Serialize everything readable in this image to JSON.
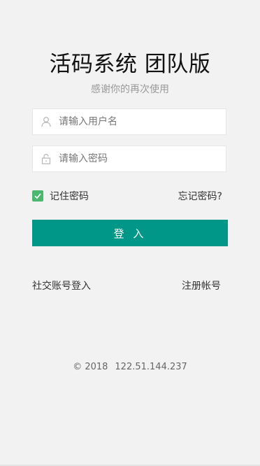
{
  "header": {
    "title": "活码系统 团队版",
    "subtitle": "感谢你的再次使用"
  },
  "form": {
    "username_placeholder": "请输入用户名",
    "username_value": "",
    "password_placeholder": "请输入密码",
    "password_value": "",
    "remember_label": "记住密码",
    "remember_checked": true,
    "forgot_label": "忘记密码?",
    "login_label": "登 入"
  },
  "links": {
    "social_login": "社交账号登入",
    "register": "注册帐号"
  },
  "footer": {
    "copyright": "© 2018",
    "ip": "122.51.144.237"
  },
  "colors": {
    "accent": "#009688",
    "checkbox": "#4cb86f",
    "background": "#f2f2f2"
  },
  "icons": {
    "username": "user-icon",
    "password": "lock-icon",
    "checkbox": "check-icon"
  }
}
